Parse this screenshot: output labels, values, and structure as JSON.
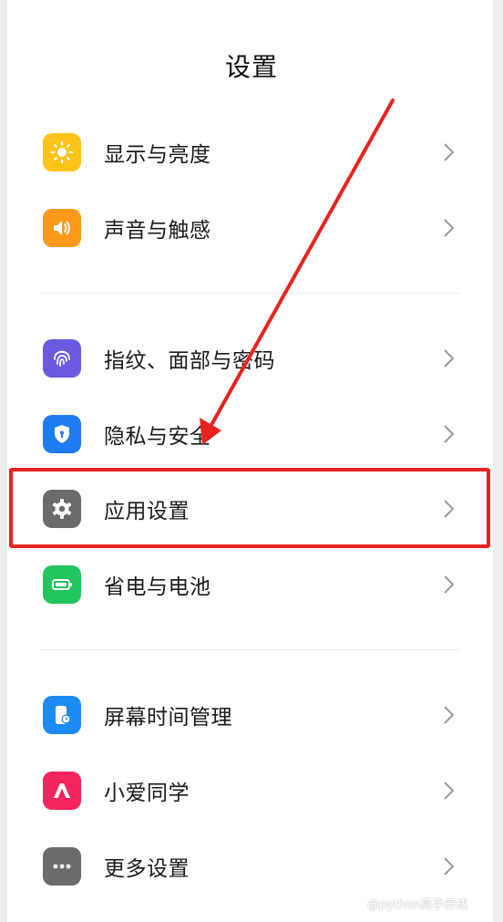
{
  "header": {
    "title": "设置"
  },
  "items": [
    {
      "label": "显示与亮度",
      "icon": "sun-icon",
      "color": "#fcc419"
    },
    {
      "label": "声音与触感",
      "icon": "speaker-icon",
      "color": "#fb9a1a"
    },
    {
      "label": "指纹、面部与密码",
      "icon": "fingerprint-icon",
      "color": "#6a5ae0"
    },
    {
      "label": "隐私与安全",
      "icon": "shield-icon",
      "color": "#1d7cf2"
    },
    {
      "label": "应用设置",
      "icon": "gear-icon",
      "color": "#6b6b6b"
    },
    {
      "label": "省电与电池",
      "icon": "battery-icon",
      "color": "#22c55e"
    },
    {
      "label": "屏幕时间管理",
      "icon": "screen-time-icon",
      "color": "#1d8cf2"
    },
    {
      "label": "小爱同学",
      "icon": "xiaoai-icon",
      "color": "#f3255f"
    },
    {
      "label": "更多设置",
      "icon": "more-icon",
      "color": "#6b6b6b"
    }
  ],
  "annotation": {
    "highlight_color": "#e8231f"
  },
  "watermark": "@python高手养成"
}
